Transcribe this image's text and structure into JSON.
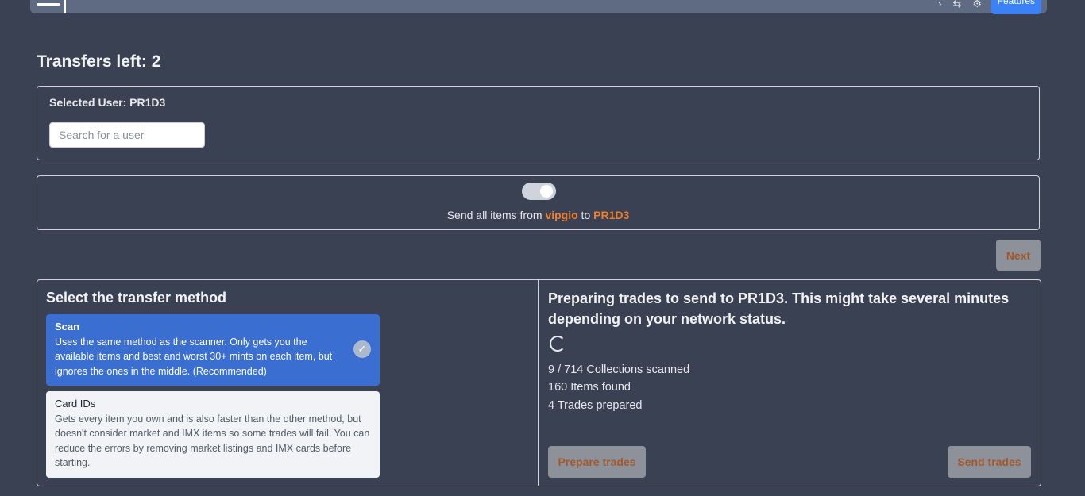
{
  "topbar": {
    "features_label": "Features"
  },
  "page": {
    "title": "Transfers left: 2"
  },
  "user_select": {
    "selected_label": "Selected User: PR1D3",
    "search_placeholder": "Search for a user"
  },
  "send_all": {
    "prefix": "Send all items from ",
    "from_user": "vipgio",
    "middle": " to ",
    "to_user": "PR1D3",
    "toggle_on": true
  },
  "next_label": "Next",
  "method": {
    "title": "Select the transfer method",
    "options": [
      {
        "title": "Scan",
        "description": "Uses the same method as the scanner. Only gets you the available items and best and worst 30+ mints on each item, but ignores the ones in the middle. (Recommended)",
        "selected": true
      },
      {
        "title": "Card IDs",
        "description": "Gets every item you own and is also faster than the other method, but doesn't consider market and IMX items so some trades will fail. You can reduce the errors by removing market listings and IMX cards before starting.",
        "selected": false
      }
    ]
  },
  "progress": {
    "title": "Preparing trades to send to PR1D3. This might take several minutes depending on your network status.",
    "collections": "9 / 714 Collections scanned",
    "items": "160 Items found",
    "trades": "4 Trades prepared",
    "prepare_label": "Prepare trades",
    "send_label": "Send trades"
  },
  "colors": {
    "background": "#3a4152",
    "accent_orange": "#f07d2c",
    "selected_option": "#3a6fd1"
  }
}
